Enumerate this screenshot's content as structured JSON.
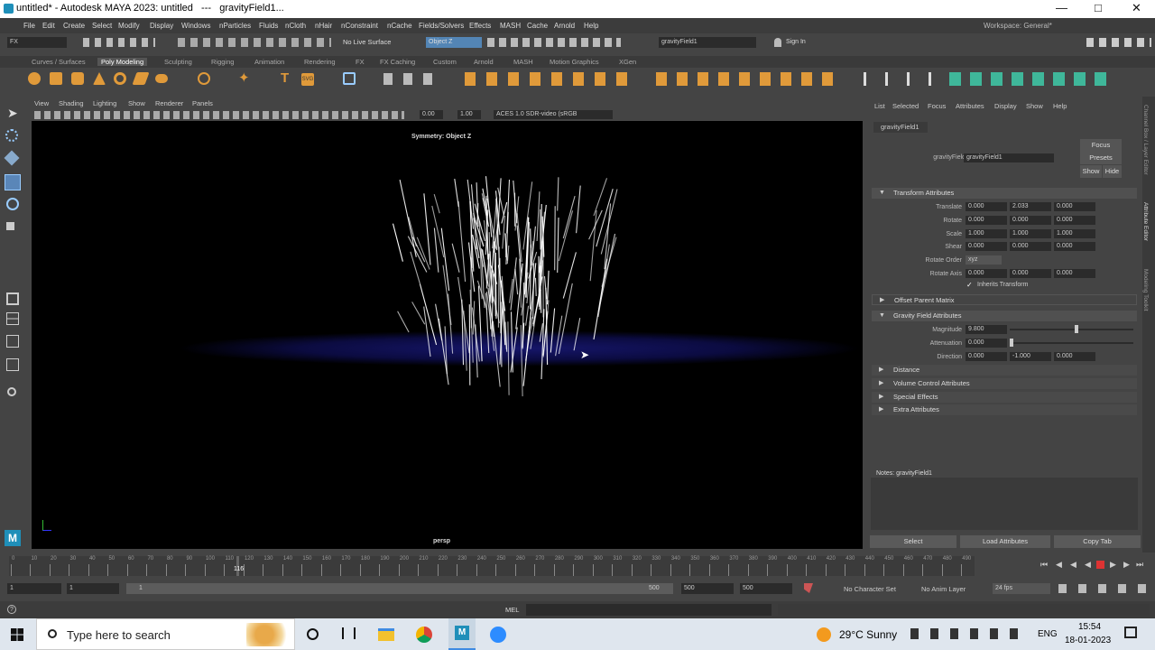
{
  "window": {
    "title": "untitled* - Autodesk MAYA 2023: untitled   ---   gravityField1..."
  },
  "menu": [
    "File",
    "Edit",
    "Create",
    "Select",
    "Modify",
    "Display",
    "Windows",
    "nParticles",
    "Fluids",
    "nCloth",
    "nHair",
    "nConstraint",
    "nCache",
    "Fields/Solvers",
    "Effects",
    "MASH",
    "Cache",
    "Arnold",
    "Help"
  ],
  "workspace": "Workspace:  General*",
  "status": {
    "menuset": "FX",
    "live": "No Live Surface",
    "symmetry": "Object Z",
    "name_field": "gravityField1",
    "signin": "Sign In"
  },
  "shelf_tabs": [
    "Curves / Surfaces",
    "Poly Modeling",
    "Sculpting",
    "Rigging",
    "Animation",
    "Rendering",
    "FX",
    "FX Caching",
    "Custom",
    "Arnold",
    "MASH",
    "Motion Graphics",
    "XGen"
  ],
  "viewport": {
    "menus": [
      "View",
      "Shading",
      "Lighting",
      "Show",
      "Renderer",
      "Panels"
    ],
    "exposure": "0.00",
    "gamma": "1.00",
    "colorspace": "ACES 1.0 SDR-video (sRGB",
    "symmetry_label": "Symmetry: Object Z",
    "camera": "persp"
  },
  "attr": {
    "menu": [
      "List",
      "Selected",
      "Focus",
      "Attributes",
      "Display",
      "Show",
      "Help"
    ],
    "tab": "gravityField1",
    "node_label": "gravityField:",
    "node_value": "gravityField1",
    "buttons": {
      "focus": "Focus",
      "presets": "Presets",
      "show": "Show",
      "hide": "Hide"
    },
    "transform_header": "Transform Attributes",
    "translate": {
      "label": "Translate",
      "x": "0.000",
      "y": "2.033",
      "z": "0.000"
    },
    "rotate": {
      "label": "Rotate",
      "x": "0.000",
      "y": "0.000",
      "z": "0.000"
    },
    "scale": {
      "label": "Scale",
      "x": "1.000",
      "y": "1.000",
      "z": "1.000"
    },
    "shear": {
      "label": "Shear",
      "x": "0.000",
      "y": "0.000",
      "z": "0.000"
    },
    "rotate_order": {
      "label": "Rotate Order",
      "value": "xyz"
    },
    "rotate_axis": {
      "label": "Rotate Axis",
      "x": "0.000",
      "y": "0.000",
      "z": "0.000"
    },
    "inherits": "Inherits Transform",
    "offset_header": "Offset Parent Matrix",
    "gravity_header": "Gravity Field Attributes",
    "magnitude": {
      "label": "Magnitude",
      "value": "9.800"
    },
    "attenuation": {
      "label": "Attenuation",
      "value": "0.000"
    },
    "direction": {
      "label": "Direction",
      "x": "0.000",
      "y": "-1.000",
      "z": "0.000"
    },
    "collapsed": [
      "Distance",
      "Volume Control Attributes",
      "Special Effects",
      "Extra Attributes"
    ],
    "notes": "Notes:  gravityField1",
    "bottom_buttons": [
      "Select",
      "Load Attributes",
      "Copy Tab"
    ],
    "side_tabs": [
      "Channel Box / Layer Editor",
      "Attribute Editor",
      "Modeling Toolkit"
    ]
  },
  "timeline": {
    "ticks": [
      "0",
      "10",
      "20",
      "30",
      "40",
      "50",
      "60",
      "70",
      "80",
      "90",
      "100",
      "110",
      "120",
      "130",
      "140",
      "150",
      "160",
      "170",
      "180",
      "190",
      "200",
      "210",
      "220",
      "230",
      "240",
      "250",
      "260",
      "270",
      "280",
      "290",
      "300",
      "310",
      "320",
      "330",
      "340",
      "350",
      "360",
      "370",
      "380",
      "390",
      "400",
      "410",
      "420",
      "430",
      "440",
      "450",
      "460",
      "470",
      "480",
      "490"
    ],
    "current": "116"
  },
  "range": {
    "start": "1",
    "start2": "1",
    "slider_start": "1",
    "slider_end": "500",
    "end": "500",
    "end2": "500",
    "char_set": "No Character Set",
    "anim_layer": "No Anim Layer",
    "fps": "24 fps"
  },
  "cmd": {
    "lang": "MEL"
  },
  "taskbar": {
    "search": "Type here to search",
    "weather": "29°C  Sunny",
    "lang": "ENG",
    "time": "15:54",
    "date": "18-01-2023"
  }
}
